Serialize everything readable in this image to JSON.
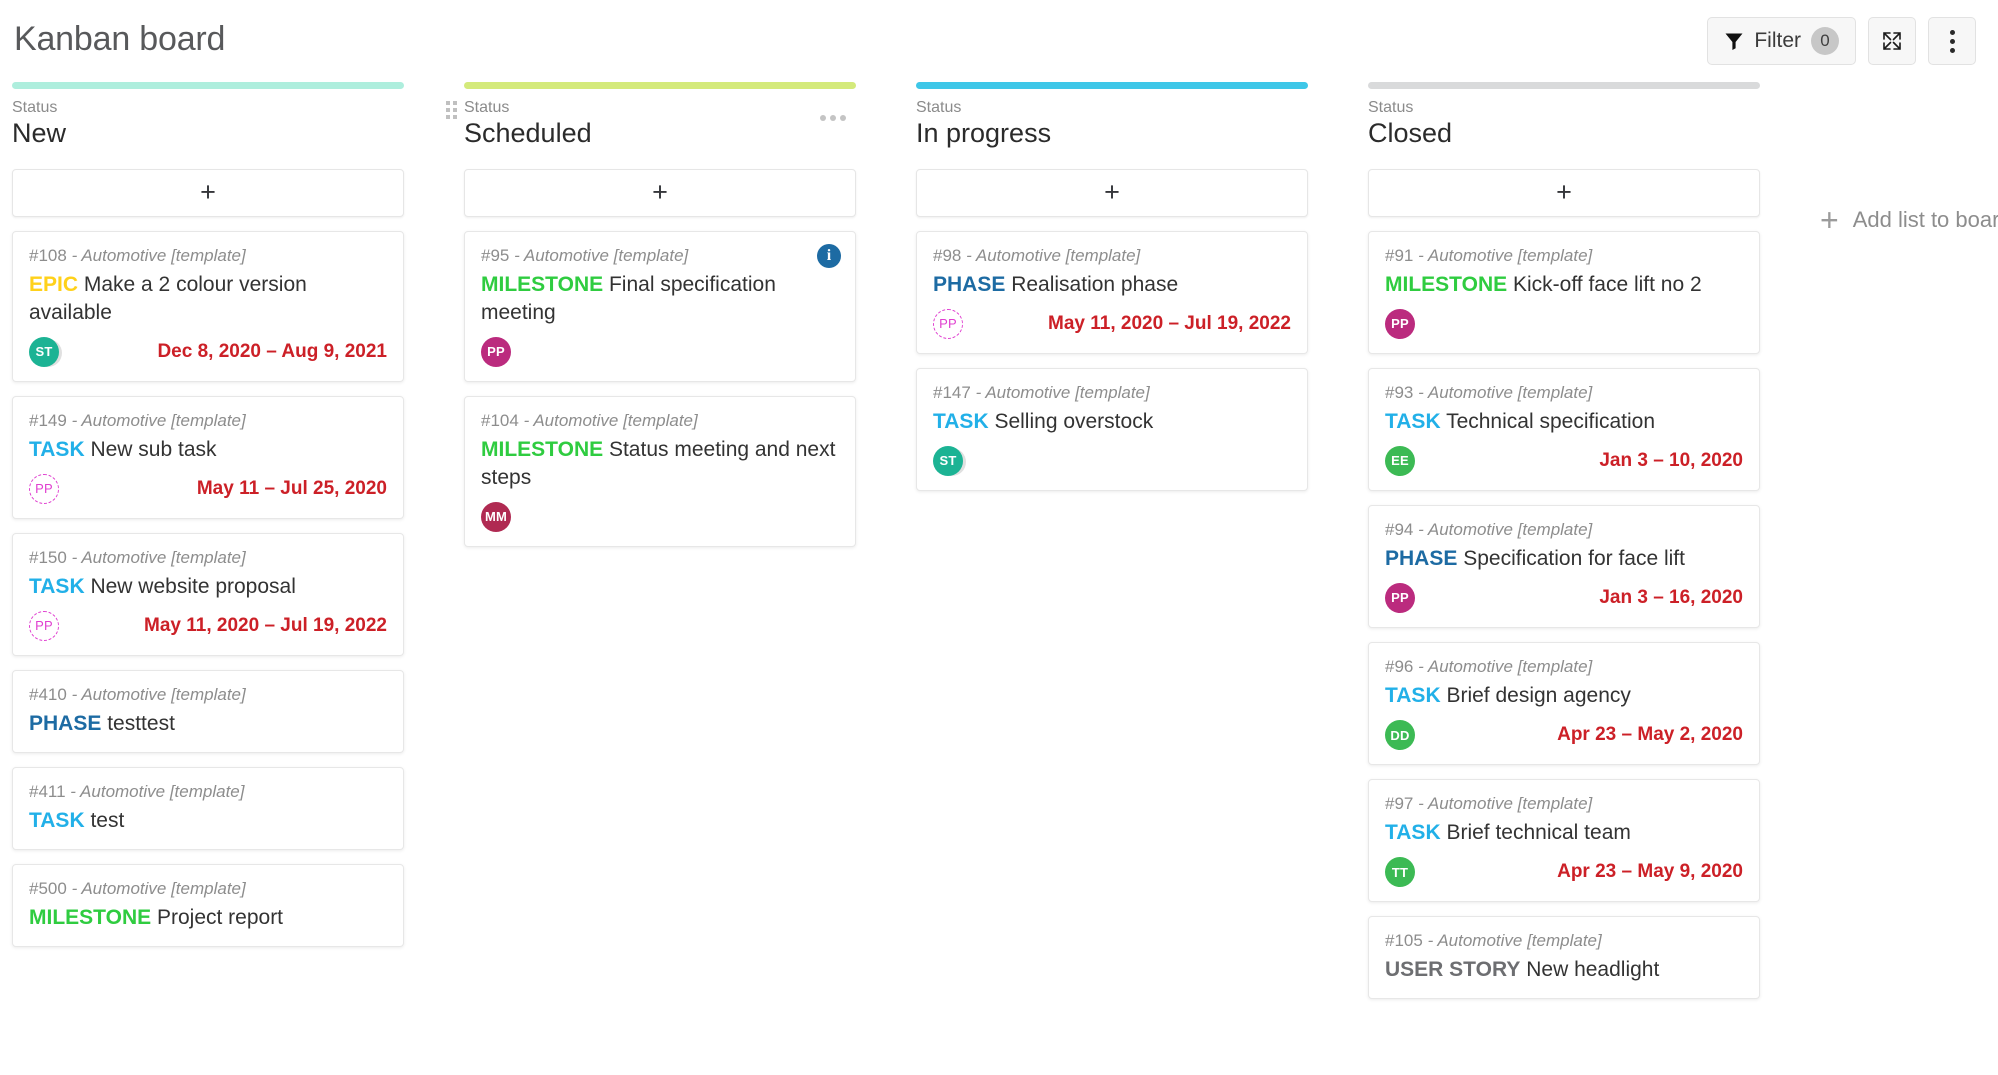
{
  "header": {
    "title": "Kanban board",
    "filter_label": "Filter",
    "filter_count": "0",
    "fullscreen_icon": "expand-icon",
    "menu_icon": "kebab-menu-icon"
  },
  "board": {
    "add_list_label": "Add list to board",
    "add_card_label": "+",
    "status_label": "Status",
    "columns": [
      {
        "id": "new",
        "name": "New",
        "status_label": "Status",
        "accent": "#aeeedd",
        "has_drag_handle": false,
        "has_menu": false,
        "cards": [
          {
            "id": "#108",
            "project": "- Automotive [template]",
            "type": "EPIC",
            "type_class": "EPIC",
            "title": "Make a 2 colour version available",
            "avatar": {
              "initials": "ST",
              "color": "#1cb394",
              "style": "solid-ringed"
            },
            "dates": "Dec 8, 2020 – Aug 9, 2021",
            "info": false
          },
          {
            "id": "#149",
            "project": "- Automotive [template]",
            "type": "TASK",
            "type_class": "TASK",
            "title": "New sub task",
            "avatar": {
              "initials": "PP",
              "color": "#e040d0",
              "style": "dashed"
            },
            "dates": "May 11 – Jul 25, 2020",
            "info": false
          },
          {
            "id": "#150",
            "project": "- Automotive [template]",
            "type": "TASK",
            "type_class": "TASK",
            "title": "New website proposal",
            "avatar": {
              "initials": "PP",
              "color": "#e040d0",
              "style": "dashed"
            },
            "dates": "May 11, 2020 – Jul 19, 2022",
            "info": false
          },
          {
            "id": "#410",
            "project": "- Automotive [template]",
            "type": "PHASE",
            "type_class": "PHASE",
            "title": "testtest",
            "avatar": null,
            "dates": "",
            "info": false
          },
          {
            "id": "#411",
            "project": "- Automotive [template]",
            "type": "TASK",
            "type_class": "TASK",
            "title": "test",
            "avatar": null,
            "dates": "",
            "info": false
          },
          {
            "id": "#500",
            "project": "- Automotive [template]",
            "type": "MILESTONE",
            "type_class": "MILESTONE",
            "title": "Project report",
            "avatar": null,
            "dates": "",
            "info": false
          }
        ]
      },
      {
        "id": "scheduled",
        "name": "Scheduled",
        "status_label": "Status",
        "accent": "#d4ea7b",
        "has_drag_handle": true,
        "has_menu": true,
        "cards": [
          {
            "id": "#95",
            "project": "- Automotive [template]",
            "type": "MILESTONE",
            "type_class": "MILESTONE",
            "title": "Final specification meeting",
            "avatar": {
              "initials": "PP",
              "color": "#bb2b7e",
              "style": "solid"
            },
            "dates": "",
            "info": true
          },
          {
            "id": "#104",
            "project": "- Automotive [template]",
            "type": "MILESTONE",
            "type_class": "MILESTONE",
            "title": "Status meeting and next steps",
            "avatar": {
              "initials": "MM",
              "color": "#b02a52",
              "style": "solid"
            },
            "dates": "",
            "info": false
          }
        ]
      },
      {
        "id": "in-progress",
        "name": "In progress",
        "status_label": "Status",
        "accent": "#3ec7e8",
        "has_drag_handle": false,
        "has_menu": false,
        "cards": [
          {
            "id": "#98",
            "project": "- Automotive [template]",
            "type": "PHASE",
            "type_class": "PHASE",
            "title": "Realisation phase",
            "avatar": {
              "initials": "PP",
              "color": "#e040d0",
              "style": "dashed"
            },
            "dates": "May 11, 2020 – Jul 19, 2022",
            "info": false
          },
          {
            "id": "#147",
            "project": "- Automotive [template]",
            "type": "TASK",
            "type_class": "TASK",
            "title": "Selling overstock",
            "avatar": {
              "initials": "ST",
              "color": "#1cb394",
              "style": "solid-ringed"
            },
            "dates": "",
            "info": false
          }
        ]
      },
      {
        "id": "closed",
        "name": "Closed",
        "status_label": "Status",
        "accent": "#d9dadb",
        "has_drag_handle": false,
        "has_menu": false,
        "cards": [
          {
            "id": "#91",
            "project": "- Automotive [template]",
            "type": "MILESTONE",
            "type_class": "MILESTONE",
            "title": "Kick-off face lift no 2",
            "avatar": {
              "initials": "PP",
              "color": "#bb2b7e",
              "style": "solid"
            },
            "dates": "",
            "info": false
          },
          {
            "id": "#93",
            "project": "- Automotive [template]",
            "type": "TASK",
            "type_class": "TASK",
            "title": "Technical specification",
            "avatar": {
              "initials": "EE",
              "color": "#3cba54",
              "style": "solid"
            },
            "dates": "Jan 3 – 10, 2020",
            "info": false
          },
          {
            "id": "#94",
            "project": "- Automotive [template]",
            "type": "PHASE",
            "type_class": "PHASE",
            "title": "Specification for face lift",
            "avatar": {
              "initials": "PP",
              "color": "#bb2b7e",
              "style": "solid"
            },
            "dates": "Jan 3 – 16, 2020",
            "info": false
          },
          {
            "id": "#96",
            "project": "- Automotive [template]",
            "type": "TASK",
            "type_class": "TASK",
            "title": "Brief design agency",
            "avatar": {
              "initials": "DD",
              "color": "#3cba54",
              "style": "solid"
            },
            "dates": "Apr 23 – May 2, 2020",
            "info": false
          },
          {
            "id": "#97",
            "project": "- Automotive [template]",
            "type": "TASK",
            "type_class": "TASK",
            "title": "Brief technical team",
            "avatar": {
              "initials": "TT",
              "color": "#3cba54",
              "style": "solid"
            },
            "dates": "Apr 23 – May 9, 2020",
            "info": false
          },
          {
            "id": "#105",
            "project": "- Automotive [template]",
            "type": "USER STORY",
            "type_class": "USERSTORY",
            "title": "New headlight",
            "avatar": null,
            "dates": "",
            "info": false
          }
        ]
      }
    ]
  }
}
